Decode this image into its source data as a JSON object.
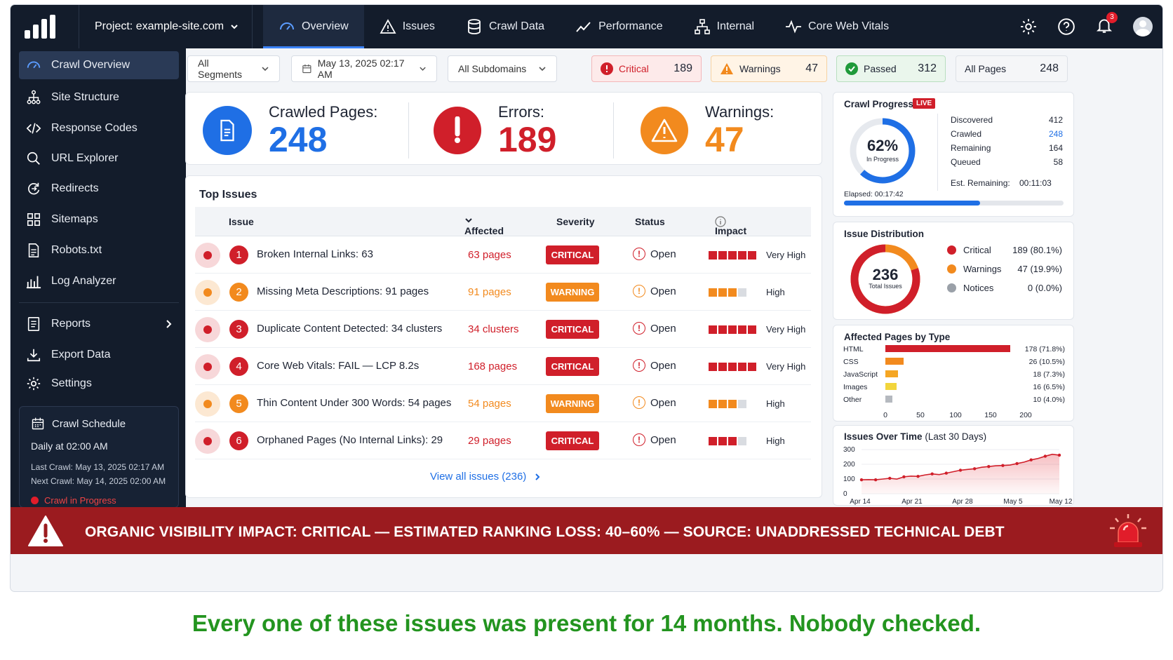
{
  "topnav": {
    "project_label": "Project: example-site.com",
    "tabs": [
      {
        "label": "Overview",
        "icon": "gauge-icon"
      },
      {
        "label": "Issues",
        "icon": "warning-icon"
      },
      {
        "label": "Crawl Data",
        "icon": "database-icon"
      },
      {
        "label": "Performance",
        "icon": "trend-icon"
      },
      {
        "label": "Internal",
        "icon": "sitemap-icon"
      },
      {
        "label": "Core Web Vitals",
        "icon": "pulse-icon"
      }
    ],
    "notification_count": "3"
  },
  "sidebar": {
    "items": [
      {
        "label": "Crawl Overview",
        "icon": "gauge-icon"
      },
      {
        "label": "Site Structure",
        "icon": "hierarchy-icon"
      },
      {
        "label": "Response Codes",
        "icon": "code-icon"
      },
      {
        "label": "URL Explorer",
        "icon": "search-icon"
      },
      {
        "label": "Redirects",
        "icon": "redirect-icon"
      },
      {
        "label": "Sitemaps",
        "icon": "grid-icon"
      },
      {
        "label": "Robots.txt",
        "icon": "file-icon"
      },
      {
        "label": "Log Analyzer",
        "icon": "bar-chart-icon"
      },
      {
        "label": "Reports",
        "icon": "report-icon"
      },
      {
        "label": "Export Data",
        "icon": "download-icon"
      },
      {
        "label": "Settings",
        "icon": "gear-icon"
      }
    ],
    "schedule": {
      "title": "Crawl Schedule",
      "daily": "Daily at 02:00 AM",
      "last": "Last Crawl: May 13, 2025 02:17 AM",
      "next": "Next Crawl: May 14, 2025 02:00 AM",
      "status": "Crawl in Progress"
    }
  },
  "filters": {
    "segments": "All Segments",
    "date": "May 13, 2025 02:17 AM",
    "subdomains": "All Subdomains",
    "chips": [
      {
        "label": "Critical",
        "value": "189"
      },
      {
        "label": "Warnings",
        "value": "47"
      },
      {
        "label": "Passed",
        "value": "312"
      },
      {
        "label": "All Pages",
        "value": "248"
      }
    ]
  },
  "stats": {
    "crawled_label": "Crawled Pages:",
    "crawled_value": "248",
    "errors_label": "Errors:",
    "errors_value": "189",
    "warnings_label": "Warnings:",
    "warnings_value": "47"
  },
  "issues": {
    "title": "Top Issues",
    "columns": {
      "issue": "Issue",
      "affected": "Affected",
      "severity": "Severity",
      "status": "Status",
      "impact": "Impact"
    },
    "rows": [
      {
        "n": "1",
        "name": "Broken Internal Links: 63",
        "affected": "63 pages",
        "severity": "CRITICAL",
        "status": "Open",
        "impact": "Very High",
        "level": 5
      },
      {
        "n": "2",
        "name": "Missing Meta Descriptions: 91 pages",
        "affected": "91 pages",
        "severity": "WARNING",
        "status": "Open",
        "impact": "High",
        "level": 3
      },
      {
        "n": "3",
        "name": "Duplicate Content Detected: 34 clusters",
        "affected": "34 clusters",
        "severity": "CRITICAL",
        "status": "Open",
        "impact": "Very High",
        "level": 5
      },
      {
        "n": "4",
        "name": "Core Web Vitals: FAIL — LCP 8.2s",
        "affected": "168 pages",
        "severity": "CRITICAL",
        "status": "Open",
        "impact": "Very High",
        "level": 5
      },
      {
        "n": "5",
        "name": "Thin Content Under 300 Words: 54 pages",
        "affected": "54 pages",
        "severity": "WARNING",
        "status": "Open",
        "impact": "High",
        "level": 3
      },
      {
        "n": "6",
        "name": "Orphaned Pages (No Internal Links): 29",
        "affected": "29 pages",
        "severity": "CRITICAL",
        "status": "Open",
        "impact": "High",
        "level": 3
      }
    ],
    "view_all": "View all issues (236)"
  },
  "crawl_progress": {
    "title": "Crawl Progress",
    "live": "LIVE",
    "percent": "62%",
    "percent_sub": "In Progress",
    "fraction": 0.62,
    "rows": [
      {
        "k": "Discovered",
        "v": "412"
      },
      {
        "k": "Crawled",
        "v": "248"
      },
      {
        "k": "Remaining",
        "v": "164"
      },
      {
        "k": "Queued",
        "v": "58"
      }
    ],
    "est_label": "Est. Remaining:",
    "est_value": "00:11:03",
    "elapsed": "Elapsed:  00:17:42"
  },
  "distribution": {
    "title": "Issue Distribution",
    "total": "236",
    "total_sub": "Total Issues",
    "items": [
      {
        "label": "Critical",
        "value": "189 (80.1%)",
        "color": "#d01f2a"
      },
      {
        "label": "Warnings",
        "value": "47 (19.9%)",
        "color": "#f28a1e"
      },
      {
        "label": "Notices",
        "value": "0 (0.0%)",
        "color": "#9aa0a8"
      }
    ]
  },
  "chart_data": [
    {
      "type": "bar",
      "orientation": "horizontal",
      "title": "Affected Pages by Type",
      "categories": [
        "HTML",
        "CSS",
        "JavaScript",
        "Images",
        "Other"
      ],
      "values": [
        178,
        26,
        18,
        16,
        10
      ],
      "labels": [
        "178 (71.8%)",
        "26 (10.5%)",
        "18 (7.3%)",
        "16 (6.5%)",
        "10 (4.0%)"
      ],
      "colors": [
        "#d01f2a",
        "#f28a1e",
        "#f5a623",
        "#f2d53c",
        "#b5b9bf"
      ],
      "xlim": [
        0,
        200
      ],
      "xticks": [
        "0",
        "50",
        "100",
        "150",
        "200"
      ]
    },
    {
      "type": "area",
      "title": "Issues Over Time",
      "title_note": "(Last 30 Days)",
      "ylim": [
        0,
        300
      ],
      "yticks": [
        "0",
        "100",
        "200",
        "300"
      ],
      "xticks": [
        "Apr 14",
        "Apr 21",
        "Apr 28",
        "May 5",
        "May 12"
      ],
      "values": [
        95,
        96,
        95,
        100,
        105,
        100,
        115,
        120,
        118,
        128,
        135,
        130,
        140,
        150,
        160,
        165,
        170,
        180,
        185,
        190,
        192,
        195,
        205,
        215,
        230,
        240,
        255,
        268,
        262
      ]
    }
  ],
  "banner": {
    "text": "ORGANIC VISIBILITY IMPACT: CRITICAL — ESTIMATED RANKING LOSS: 40–60% — SOURCE: UNADDRESSED TECHNICAL DEBT"
  },
  "caption": "Every one of these issues was present for 14 months. Nobody checked."
}
